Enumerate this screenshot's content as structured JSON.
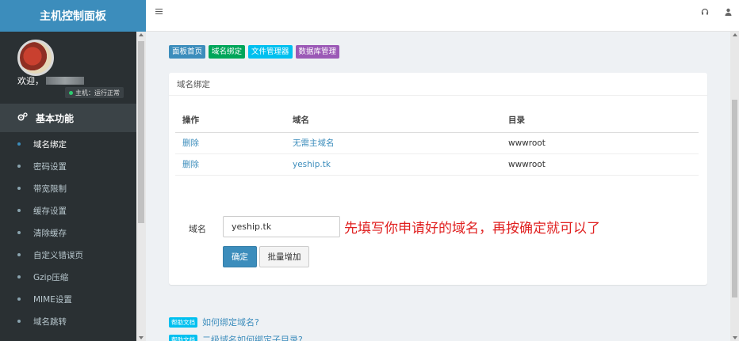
{
  "brand": {
    "title": "主机控制面板"
  },
  "user": {
    "welcome": "欢迎，",
    "status": "主机：运行正常"
  },
  "sidebar": {
    "section": "基本功能",
    "items": [
      {
        "label": "域名绑定"
      },
      {
        "label": "密码设置"
      },
      {
        "label": "带宽限制"
      },
      {
        "label": "缓存设置"
      },
      {
        "label": "清除缓存"
      },
      {
        "label": "自定义错误页"
      },
      {
        "label": "Gzip压缩"
      },
      {
        "label": "MIME设置"
      },
      {
        "label": "域名跳转"
      }
    ]
  },
  "quick_links": [
    "面板首页",
    "域名绑定",
    "文件管理器",
    "数据库管理"
  ],
  "panel": {
    "title": "域名绑定",
    "table": {
      "headers": [
        "操作",
        "域名",
        "目录"
      ],
      "rows": [
        {
          "action": "删除",
          "domain": "无需主域名",
          "dir": "wwwroot"
        },
        {
          "action": "删除",
          "domain": "yeship.tk",
          "dir": "wwwroot"
        }
      ]
    },
    "form": {
      "label": "域名",
      "value": "yeship.tk",
      "annotation": "先填写你申请好的域名，再按确定就可以了",
      "ok_label": "确定",
      "bulk_label": "批量增加"
    }
  },
  "help": [
    {
      "tag": "帮助文档",
      "text": "如何绑定域名?"
    },
    {
      "tag": "帮助文档",
      "text": "二级域名如何绑定子目录?"
    }
  ],
  "colors": {
    "primary": "#3c8dbc",
    "sidebar": "#2a3033",
    "annotation": "#e02020"
  }
}
